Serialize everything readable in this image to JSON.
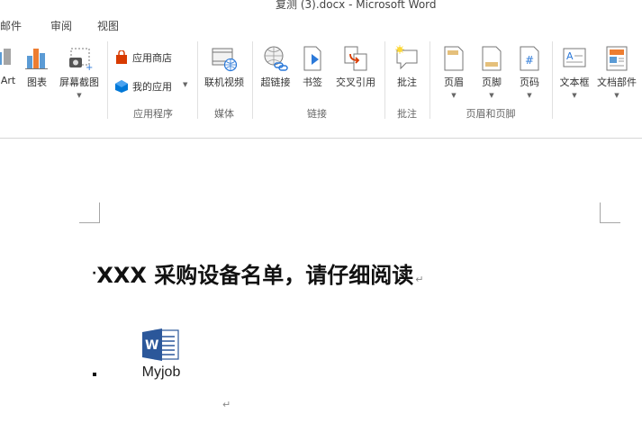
{
  "window": {
    "title": "复测 (3).docx - Microsoft Word"
  },
  "tabs": [
    "邮件",
    "审阅",
    "视图"
  ],
  "ribbon": {
    "groups": {
      "illustrations": {
        "buttons": {
          "smartart": "Art",
          "chart": "图表",
          "screenshot": "屏幕截图"
        }
      },
      "apps": {
        "label": "应用程序",
        "buttons": {
          "store": "应用商店",
          "my_apps": "我的应用"
        }
      },
      "media": {
        "label": "媒体",
        "buttons": {
          "online_video": "联机视频"
        }
      },
      "links": {
        "label": "链接",
        "buttons": {
          "hyperlink": "超链接",
          "bookmark": "书签",
          "cross_ref": "交叉引用"
        }
      },
      "comments": {
        "label": "批注",
        "buttons": {
          "comment": "批注"
        }
      },
      "header_footer": {
        "label": "页眉和页脚",
        "buttons": {
          "header": "页眉",
          "footer": "页脚",
          "page_number": "页码"
        }
      },
      "text": {
        "buttons": {
          "text_box": "文本框",
          "doc_parts": "文档部件"
        }
      }
    }
  },
  "document": {
    "heading": "XXX 采购设备名单，请仔细阅读",
    "paragraph_mark": "↵",
    "embedded_object": {
      "label": "Myjob",
      "icon": "word-document-icon"
    }
  },
  "colors": {
    "word_blue": "#2b579a",
    "store_red": "#d83b01",
    "apps_blue": "#0078d7"
  }
}
